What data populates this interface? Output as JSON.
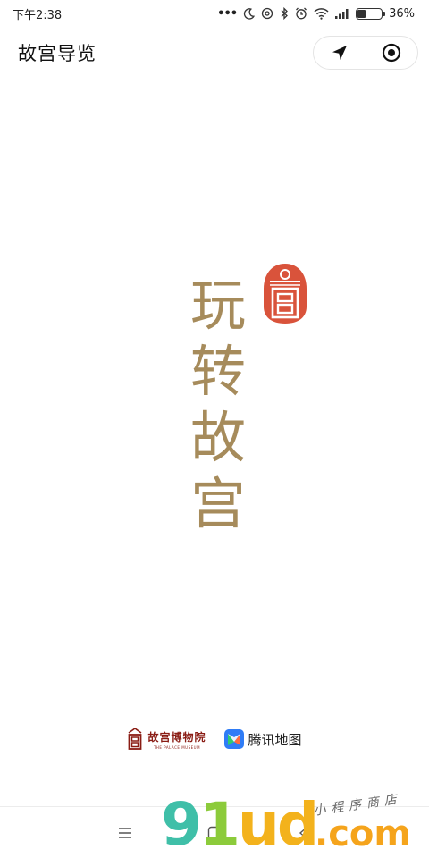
{
  "status_bar": {
    "time": "下午2:38",
    "more": "•••",
    "battery_text": "36%",
    "battery_level": 0.36
  },
  "nav": {
    "title": "故宫导览"
  },
  "hero": {
    "chars": [
      "玩",
      "转",
      "故",
      "宫"
    ]
  },
  "footer": {
    "museum_name": "故宫博物院",
    "museum_en": "THE PALACE MUSEUM",
    "map_name": "腾讯地图"
  },
  "watermark": {
    "brand_a": "9",
    "brand_b": "1",
    "brand_c": "ud",
    "brand_d": ".com",
    "tagline": "小程序商店"
  },
  "colors": {
    "hero_gold": "#a68b5b",
    "seal_red": "#d9533b",
    "museum_red": "#8a1c14"
  }
}
